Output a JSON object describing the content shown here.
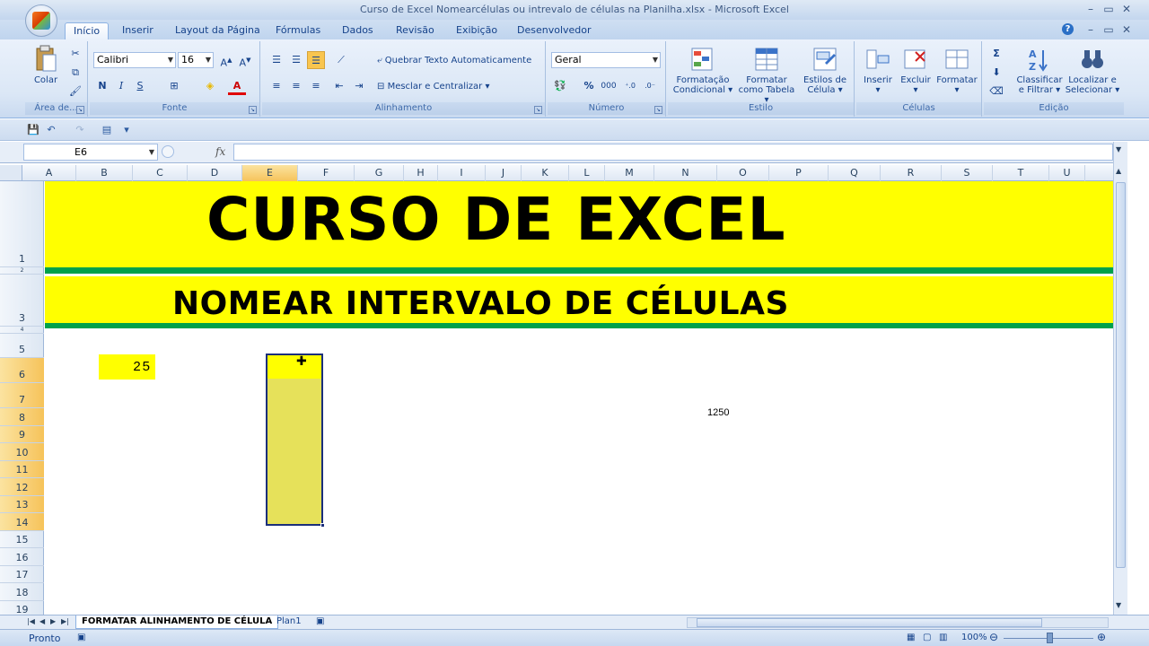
{
  "window": {
    "title": "Curso de Excel Nomearcélulas ou intrevalo de células na Planilha.xlsx - Microsoft Excel",
    "controls": [
      "–",
      "▭",
      "✕"
    ],
    "doc_controls": [
      "–",
      "▭",
      "✕"
    ]
  },
  "tabs": [
    "Início",
    "Inserir",
    "Layout da Página",
    "Fórmulas",
    "Dados",
    "Revisão",
    "Exibição",
    "Desenvolvedor"
  ],
  "ribbon": {
    "clipboard": {
      "paste": "Colar",
      "label": "Área de..."
    },
    "font": {
      "name": "Calibri",
      "size": "16",
      "bold": "N",
      "italic": "I",
      "underline": "S",
      "label": "Fonte"
    },
    "alignment": {
      "wrap": "Quebrar Texto Automaticamente",
      "merge": "Mesclar e Centralizar",
      "label": "Alinhamento"
    },
    "number": {
      "format": "Geral",
      "percent": "%",
      "thousands": "000",
      "label": "Número"
    },
    "style": {
      "conditional": [
        "Formatação",
        "Condicional"
      ],
      "table": [
        "Formatar",
        "como Tabela"
      ],
      "cell_styles": [
        "Estilos de",
        "Célula"
      ],
      "label": "Estilo"
    },
    "cells": {
      "insert": "Inserir",
      "delete": "Excluir",
      "format": "Formatar",
      "label": "Células"
    },
    "editing": {
      "sort": [
        "Classificar",
        "e Filtrar"
      ],
      "find": [
        "Localizar e",
        "Selecionar"
      ],
      "label": "Edição"
    }
  },
  "namebox": "E6",
  "fx": "fx",
  "columns": [
    "A",
    "B",
    "C",
    "D",
    "E",
    "F",
    "G",
    "H",
    "I",
    "J",
    "K",
    "L",
    "M",
    "N",
    "O",
    "P",
    "Q",
    "R",
    "S",
    "T",
    "U"
  ],
  "selected_column": "E",
  "rows": [
    "1",
    "2",
    "3",
    "4",
    "5",
    "6",
    "7",
    "8",
    "9",
    "10",
    "11",
    "12",
    "13",
    "14",
    "15",
    "16",
    "17",
    "18",
    "19"
  ],
  "selected_rows": [
    "6",
    "7",
    "8",
    "9",
    "10",
    "11",
    "12",
    "13",
    "14"
  ],
  "cells": {
    "title": "CURSO DE EXCEL",
    "subtitle": "NOMEAR INTERVALO DE CÉLULAS",
    "B6": "25",
    "N8": "1250"
  },
  "sheet_tabs": [
    "FORMATAR ALINHAMENTO DE CÉLULA",
    "Plan1"
  ],
  "status": "Pronto",
  "zoom": "100%",
  "colors": {
    "yellow": "#ffff00",
    "green": "#00a14b",
    "selection": "#e6e15a"
  }
}
